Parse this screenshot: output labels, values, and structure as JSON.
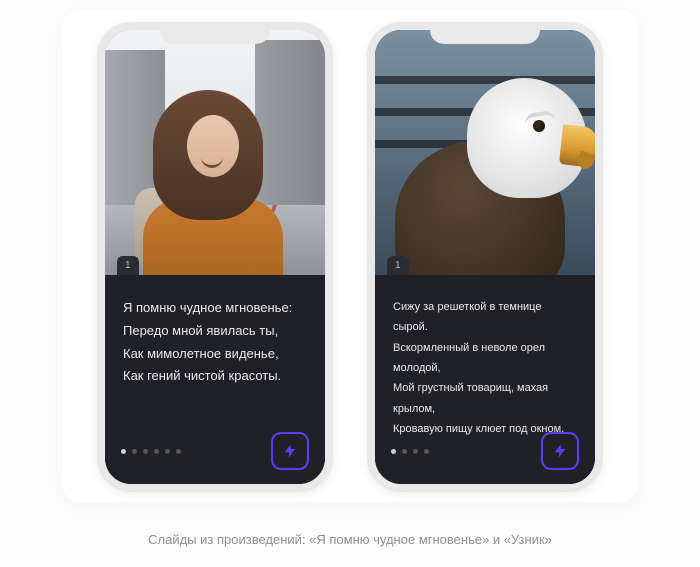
{
  "caption": "Слайды из произведений: «Я помню чудное мгновенье» и «Узник»",
  "icons": {
    "bolt": "bolt-icon"
  },
  "colors": {
    "accent": "#5b3df5",
    "panel": "#202126"
  },
  "phones": [
    {
      "page_badge": "1",
      "poem": "Я помню чудное мгновенье:\nПередо мной явилась ты,\nКак мимолетное виденье,\nКак гений чистой красоты.",
      "dots_total": 6,
      "dots_active": 0,
      "image_semantic": "woman-on-street"
    },
    {
      "page_badge": "1",
      "poem": "Сижу за решеткой в темнице сырой.\nВскормленный в неволе орел молодой,\nМой грустный товарищ, махая крылом,\nКровавую пищу клюет под окном,",
      "dots_total": 4,
      "dots_active": 0,
      "image_semantic": "bald-eagle"
    }
  ]
}
